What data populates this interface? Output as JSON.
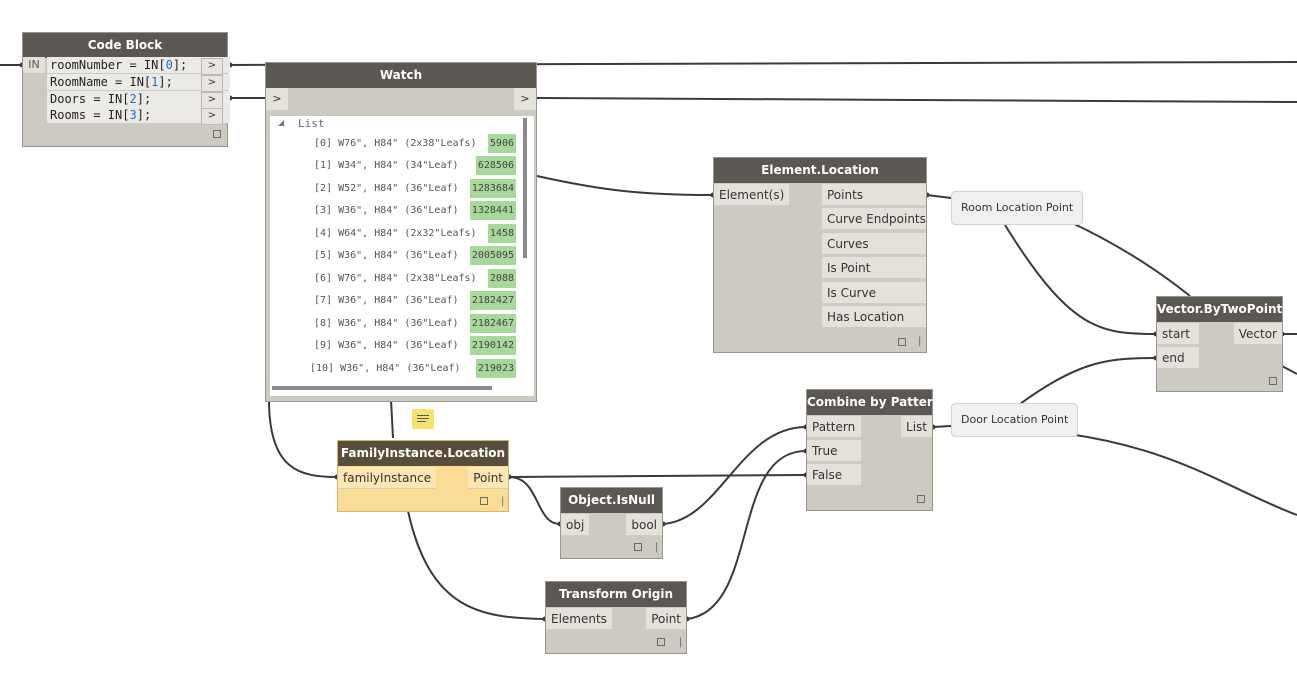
{
  "code_block": {
    "title": "Code Block",
    "in_label": "IN",
    "lines": [
      {
        "pre": "roomNumber = IN[",
        "idx": "0",
        "post": "];"
      },
      {
        "pre": "RoomName = IN[",
        "idx": "1",
        "post": "];"
      },
      {
        "pre": "Doors = IN[",
        "idx": "2",
        "post": "];"
      },
      {
        "pre": "Rooms = IN[",
        "idx": "3",
        "post": "];"
      }
    ],
    "out_glyph": ">"
  },
  "watch": {
    "title": "Watch",
    "in_glyph": ">",
    "out_glyph": ">",
    "list_label": "List",
    "rows": [
      {
        "index": "[0]",
        "text": "W76\", H84\" (2x38\"Leafs)",
        "value": "5906"
      },
      {
        "index": "[1]",
        "text": "W34\", H84\" (34\"Leaf)",
        "value": "628506"
      },
      {
        "index": "[2]",
        "text": "W52\", H84\" (36\"Leaf)",
        "value": "1283684"
      },
      {
        "index": "[3]",
        "text": "W36\", H84\" (36\"Leaf)",
        "value": "1328441"
      },
      {
        "index": "[4]",
        "text": "W64\", H84\" (2x32\"Leafs)",
        "value": "1458"
      },
      {
        "index": "[5]",
        "text": "W36\", H84\" (36\"Leaf)",
        "value": "2005095"
      },
      {
        "index": "[6]",
        "text": "W76\", H84\" (2x38\"Leafs)",
        "value": "2088"
      },
      {
        "index": "[7]",
        "text": "W36\", H84\" (36\"Leaf)",
        "value": "2182427"
      },
      {
        "index": "[8]",
        "text": "W36\", H84\" (36\"Leaf)",
        "value": "2182467"
      },
      {
        "index": "[9]",
        "text": "W36\", H84\" (36\"Leaf)",
        "value": "2190142"
      },
      {
        "index": "[10]",
        "text": "W36\", H84\" (36\"Leaf)",
        "value": "219023"
      }
    ]
  },
  "element_location": {
    "title": "Element.Location",
    "input": "Element(s)",
    "outputs": [
      "Points",
      "Curve Endpoints",
      "Curves",
      "Is Point",
      "Is Curve",
      "Has Location"
    ]
  },
  "room_location_point": "Room Location Point",
  "door_location_point": "Door Location Point",
  "vector_by_two_points": {
    "title": "Vector.ByTwoPoints",
    "inputs": [
      "start",
      "end"
    ],
    "output": "Vector"
  },
  "familyinstance_location": {
    "title": "FamilyInstance.Location",
    "input": "familyInstance",
    "output": "Point"
  },
  "object_isnull": {
    "title": "Object.IsNull",
    "input": "obj",
    "output": "bool"
  },
  "combine_by_pattern": {
    "title": "Combine by Pattern",
    "inputs": [
      "Pattern",
      "True",
      "False"
    ],
    "output": "List"
  },
  "transform_origin": {
    "title": "Transform Origin",
    "input": "Elements",
    "output": "Point"
  },
  "footer_marker": "|",
  "colors": {
    "node_body": "#cdcac4",
    "node_header": "#5b5752",
    "selected_body": "#fbdc95",
    "watch_value": "#a7d99a",
    "wire": "#3a3a3a"
  }
}
